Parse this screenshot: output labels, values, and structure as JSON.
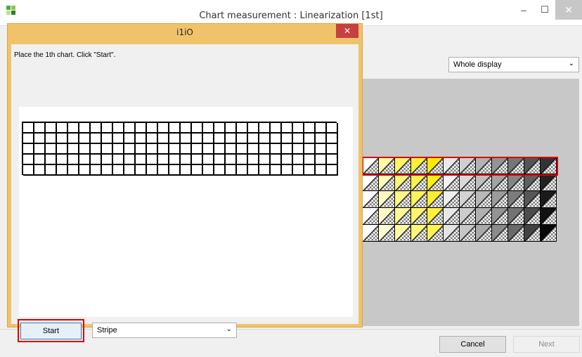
{
  "main_window": {
    "title": "Chart measurement : Linearization [1st]",
    "controls": {
      "minimize": "–",
      "maximize": "☐",
      "close": "✕"
    },
    "display_select": {
      "value": "Whole display",
      "chevron": "⌄"
    },
    "buttons": {
      "cancel": "Cancel",
      "next": "Next"
    }
  },
  "dialog": {
    "title": "i1iO",
    "close": "✕",
    "instruction": "Place the 1th chart.  Click \"Start\".",
    "start": "Start",
    "mode_select": {
      "value": "Stripe",
      "chevron": "⌄"
    }
  },
  "outline_chart": {
    "columns": 28,
    "rows": 5
  },
  "preview_chart": {
    "columns": 12,
    "rows": 5,
    "highlighted_row": 1,
    "patch_colors": [
      [
        "#ffffff",
        "#fff9a8",
        "#fff36a",
        "#fff036",
        "#ffea00",
        "#e9e9e9",
        "#cfcfcf",
        "#b2b2b2",
        "#949494",
        "#767676",
        "#555555",
        "#333333"
      ],
      [
        "#ffffff",
        "#fffab5",
        "#fff579",
        "#fff14a",
        "#ffec19",
        "#f2f2f2",
        "#d9d9d9",
        "#bebebe",
        "#a3a3a3",
        "#848484",
        "#5f5f5f",
        "#222222"
      ],
      [
        "#ffffff",
        "#fffbbf",
        "#fff788",
        "#fff35a",
        "#ffef2c",
        "#eeeeee",
        "#d3d3d3",
        "#b8b8b8",
        "#9c9c9c",
        "#7c7c7c",
        "#575757",
        "#1a1a1a"
      ],
      [
        "#ffffff",
        "#fffcc9",
        "#fff896",
        "#fff569",
        "#fff13c",
        "#e8e8e8",
        "#cccccc",
        "#b0b0b0",
        "#939393",
        "#737373",
        "#4d4d4d",
        "#111111"
      ],
      [
        "#ffffff",
        "#fffdd3",
        "#fffaa4",
        "#fff777",
        "#fff44d",
        "#e4e4e4",
        "#c6c6c6",
        "#a9a9a9",
        "#8b8b8b",
        "#6a6a6a",
        "#434343",
        "#080808"
      ]
    ],
    "icon_colors": [
      "#3fae49",
      "#8dc63f",
      "#c2e08a",
      "#2e7d32"
    ]
  }
}
